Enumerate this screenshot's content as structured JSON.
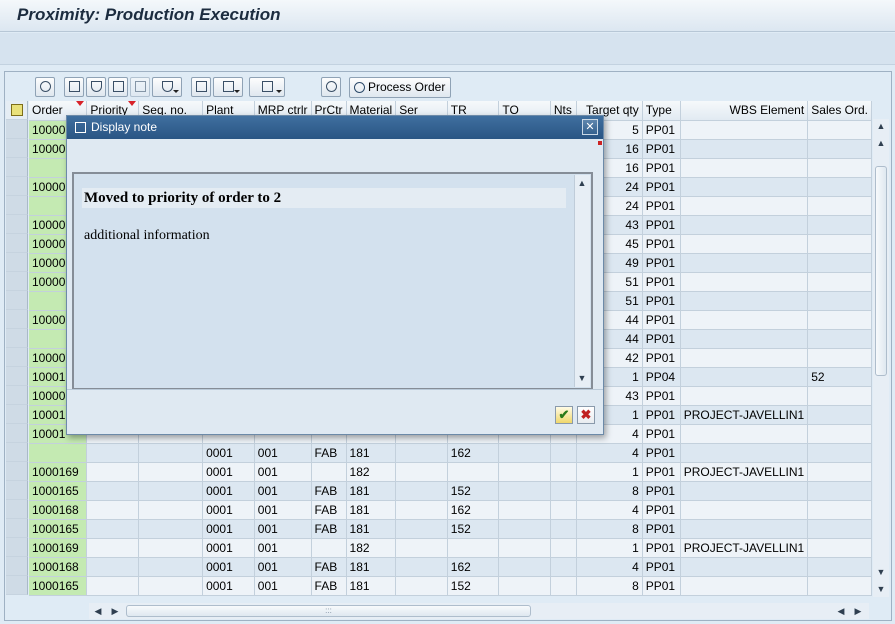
{
  "window": {
    "title": "Proximity: Production Execution"
  },
  "toolbar": {
    "process_order_label": "Process Order",
    "icons": [
      "magnify-icon",
      "print-icon",
      "filter-icon",
      "find-icon",
      "find-next-icon",
      "set-filter-icon",
      "layout-icon",
      "export-icon",
      "send-icon",
      "refresh-icon"
    ]
  },
  "table": {
    "columns": [
      "Order",
      "Priority",
      "Seq. no.",
      "Plant",
      "MRP ctrlr",
      "PrCtr",
      "Material",
      "Ser",
      "TR",
      "TO",
      "Nts",
      "Target qty",
      "Type",
      "WBS Element",
      "Sales Ord."
    ],
    "rows": [
      [
        "10000",
        "",
        "",
        "",
        "",
        "",
        "",
        "",
        "",
        "",
        "",
        "5",
        "PP01",
        "",
        ""
      ],
      [
        "10000",
        "",
        "",
        "",
        "",
        "",
        "",
        "",
        "",
        "",
        "",
        "16",
        "PP01",
        "",
        ""
      ],
      [
        "",
        "",
        "",
        "",
        "",
        "",
        "",
        "",
        "",
        "",
        "",
        "16",
        "PP01",
        "",
        ""
      ],
      [
        "10000",
        "",
        "",
        "",
        "",
        "",
        "",
        "",
        "",
        "",
        "",
        "24",
        "PP01",
        "",
        ""
      ],
      [
        "",
        "",
        "",
        "",
        "",
        "",
        "",
        "",
        "",
        "",
        "",
        "24",
        "PP01",
        "",
        ""
      ],
      [
        "10000",
        "",
        "",
        "",
        "",
        "",
        "",
        "",
        "",
        "",
        "",
        "43",
        "PP01",
        "",
        ""
      ],
      [
        "10000",
        "",
        "",
        "",
        "",
        "",
        "",
        "",
        "",
        "",
        "",
        "45",
        "PP01",
        "",
        ""
      ],
      [
        "10000",
        "",
        "",
        "",
        "",
        "",
        "",
        "",
        "",
        "",
        "",
        "49",
        "PP01",
        "",
        ""
      ],
      [
        "10000",
        "",
        "",
        "",
        "",
        "",
        "",
        "",
        "",
        "",
        "",
        "51",
        "PP01",
        "",
        ""
      ],
      [
        "",
        "",
        "",
        "",
        "",
        "",
        "",
        "",
        "",
        "",
        "",
        "51",
        "PP01",
        "",
        ""
      ],
      [
        "10000",
        "",
        "",
        "",
        "",
        "",
        "",
        "",
        "",
        "",
        "",
        "44",
        "PP01",
        "",
        ""
      ],
      [
        "",
        "",
        "",
        "",
        "",
        "",
        "",
        "",
        "",
        "",
        "",
        "44",
        "PP01",
        "",
        ""
      ],
      [
        "10000",
        "",
        "",
        "",
        "",
        "",
        "",
        "",
        "",
        "",
        "",
        "42",
        "PP01",
        "",
        ""
      ],
      [
        "10001",
        "",
        "",
        "",
        "",
        "",
        "",
        "",
        "",
        "",
        "",
        "1",
        "PP04",
        "",
        "52"
      ],
      [
        "10000",
        "",
        "",
        "",
        "",
        "",
        "",
        "",
        "",
        "",
        "",
        "43",
        "PP01",
        "",
        ""
      ],
      [
        "10001",
        "",
        "",
        "",
        "",
        "",
        "",
        "",
        "",
        "",
        "",
        "1",
        "PP01",
        "PROJECT-JAVELLIN1",
        ""
      ],
      [
        "10001",
        "",
        "",
        "",
        "",
        "",
        "",
        "",
        "",
        "",
        "",
        "4",
        "PP01",
        "",
        ""
      ],
      [
        "",
        "",
        "",
        "0001",
        "001",
        "FAB",
        "181",
        "",
        "162",
        "",
        "",
        "4",
        "PP01",
        "",
        ""
      ],
      [
        "1000169",
        "",
        "",
        "0001",
        "001",
        "",
        "182",
        "",
        "",
        "",
        "",
        "1",
        "PP01",
        "PROJECT-JAVELLIN1",
        ""
      ],
      [
        "1000165",
        "",
        "",
        "0001",
        "001",
        "FAB",
        "181",
        "",
        "152",
        "",
        "",
        "8",
        "PP01",
        "",
        ""
      ],
      [
        "1000168",
        "",
        "",
        "0001",
        "001",
        "FAB",
        "181",
        "",
        "162",
        "",
        "",
        "4",
        "PP01",
        "",
        ""
      ],
      [
        "1000165",
        "",
        "",
        "0001",
        "001",
        "FAB",
        "181",
        "",
        "152",
        "",
        "",
        "8",
        "PP01",
        "",
        ""
      ],
      [
        "1000169",
        "",
        "",
        "0001",
        "001",
        "",
        "182",
        "",
        "",
        "",
        "",
        "1",
        "PP01",
        "PROJECT-JAVELLIN1",
        ""
      ],
      [
        "1000168",
        "",
        "",
        "0001",
        "001",
        "FAB",
        "181",
        "",
        "162",
        "",
        "",
        "4",
        "PP01",
        "",
        ""
      ],
      [
        "1000165",
        "",
        "",
        "0001",
        "001",
        "FAB",
        "181",
        "",
        "152",
        "",
        "",
        "8",
        "PP01",
        "",
        ""
      ]
    ]
  },
  "dialog": {
    "title": "Display note",
    "note_heading": "Moved to priority of order to 2",
    "note_body": "additional information",
    "ok_label": "✔",
    "cancel_label": "✖"
  },
  "scroll": {
    "up": "▲",
    "down": "▼",
    "left": "◀",
    "right": "▶",
    "grip": ":::"
  }
}
